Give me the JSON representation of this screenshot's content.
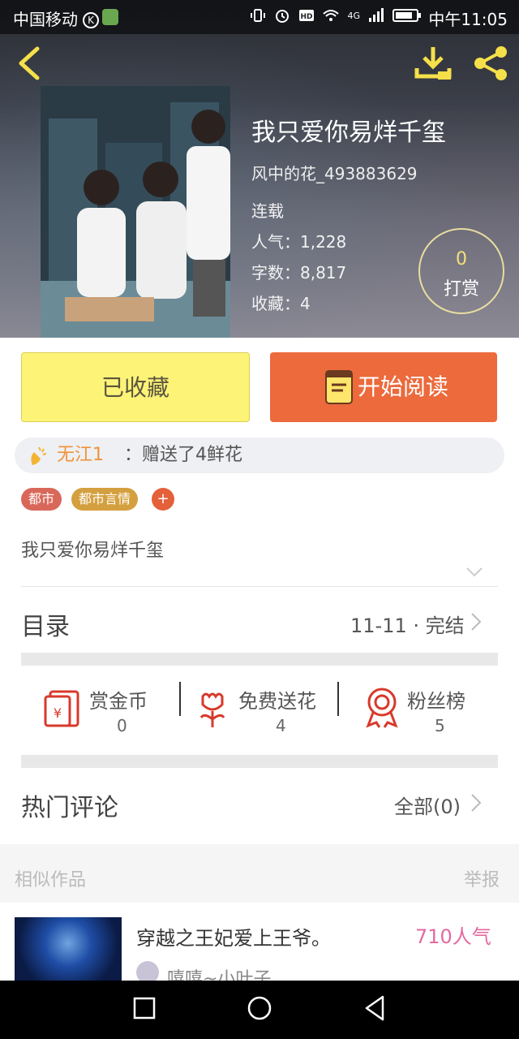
{
  "status_bar": {
    "carrier": "中国移动",
    "carrier_badge": "K",
    "network": "4G",
    "time": "中午11:05"
  },
  "book": {
    "title": "我只爱你易烊千玺",
    "author": "风中的花_493883629",
    "status": "连载",
    "popularity_label": "人气：",
    "popularity": "1,228",
    "word_count_label": "字数：",
    "word_count": "8,817",
    "favorites_label": "收藏：",
    "favorites": "4",
    "summary": "我只爱你易烊千玺"
  },
  "tip": {
    "count": "0",
    "label": "打赏"
  },
  "actions": {
    "favorited_label": "已收藏",
    "read_label": "开始阅读"
  },
  "gift_notice": {
    "user": "无江1",
    "message": "：赠送了4鲜花"
  },
  "tags": [
    {
      "label": "都市",
      "color": "#d9685a"
    },
    {
      "label": "都市言情",
      "color": "#d4a03f"
    }
  ],
  "add_tag_label": "+",
  "catalog": {
    "title": "目录",
    "latest": "11-11 · 完结"
  },
  "stats": [
    {
      "label": "赏金币",
      "value": "0",
      "icon": "red-envelope-icon"
    },
    {
      "label": "免费送花",
      "value": "4",
      "icon": "flower-icon"
    },
    {
      "label": "粉丝榜",
      "value": "5",
      "icon": "medal-icon"
    }
  ],
  "comments": {
    "title": "热门评论",
    "all_label": "全部(0)"
  },
  "similar": {
    "title": "相似作品",
    "report_label": "举报",
    "items": [
      {
        "title": "穿越之王妃爱上王爷。",
        "popularity": "710人气",
        "author": "嘻嘻~小叶子"
      }
    ]
  },
  "colors": {
    "accent_orange": "#ec6a3c",
    "favorite_yellow": "#fdf377",
    "stat_icon_red": "#d8392b",
    "popularity_pink": "#e36aa0"
  }
}
